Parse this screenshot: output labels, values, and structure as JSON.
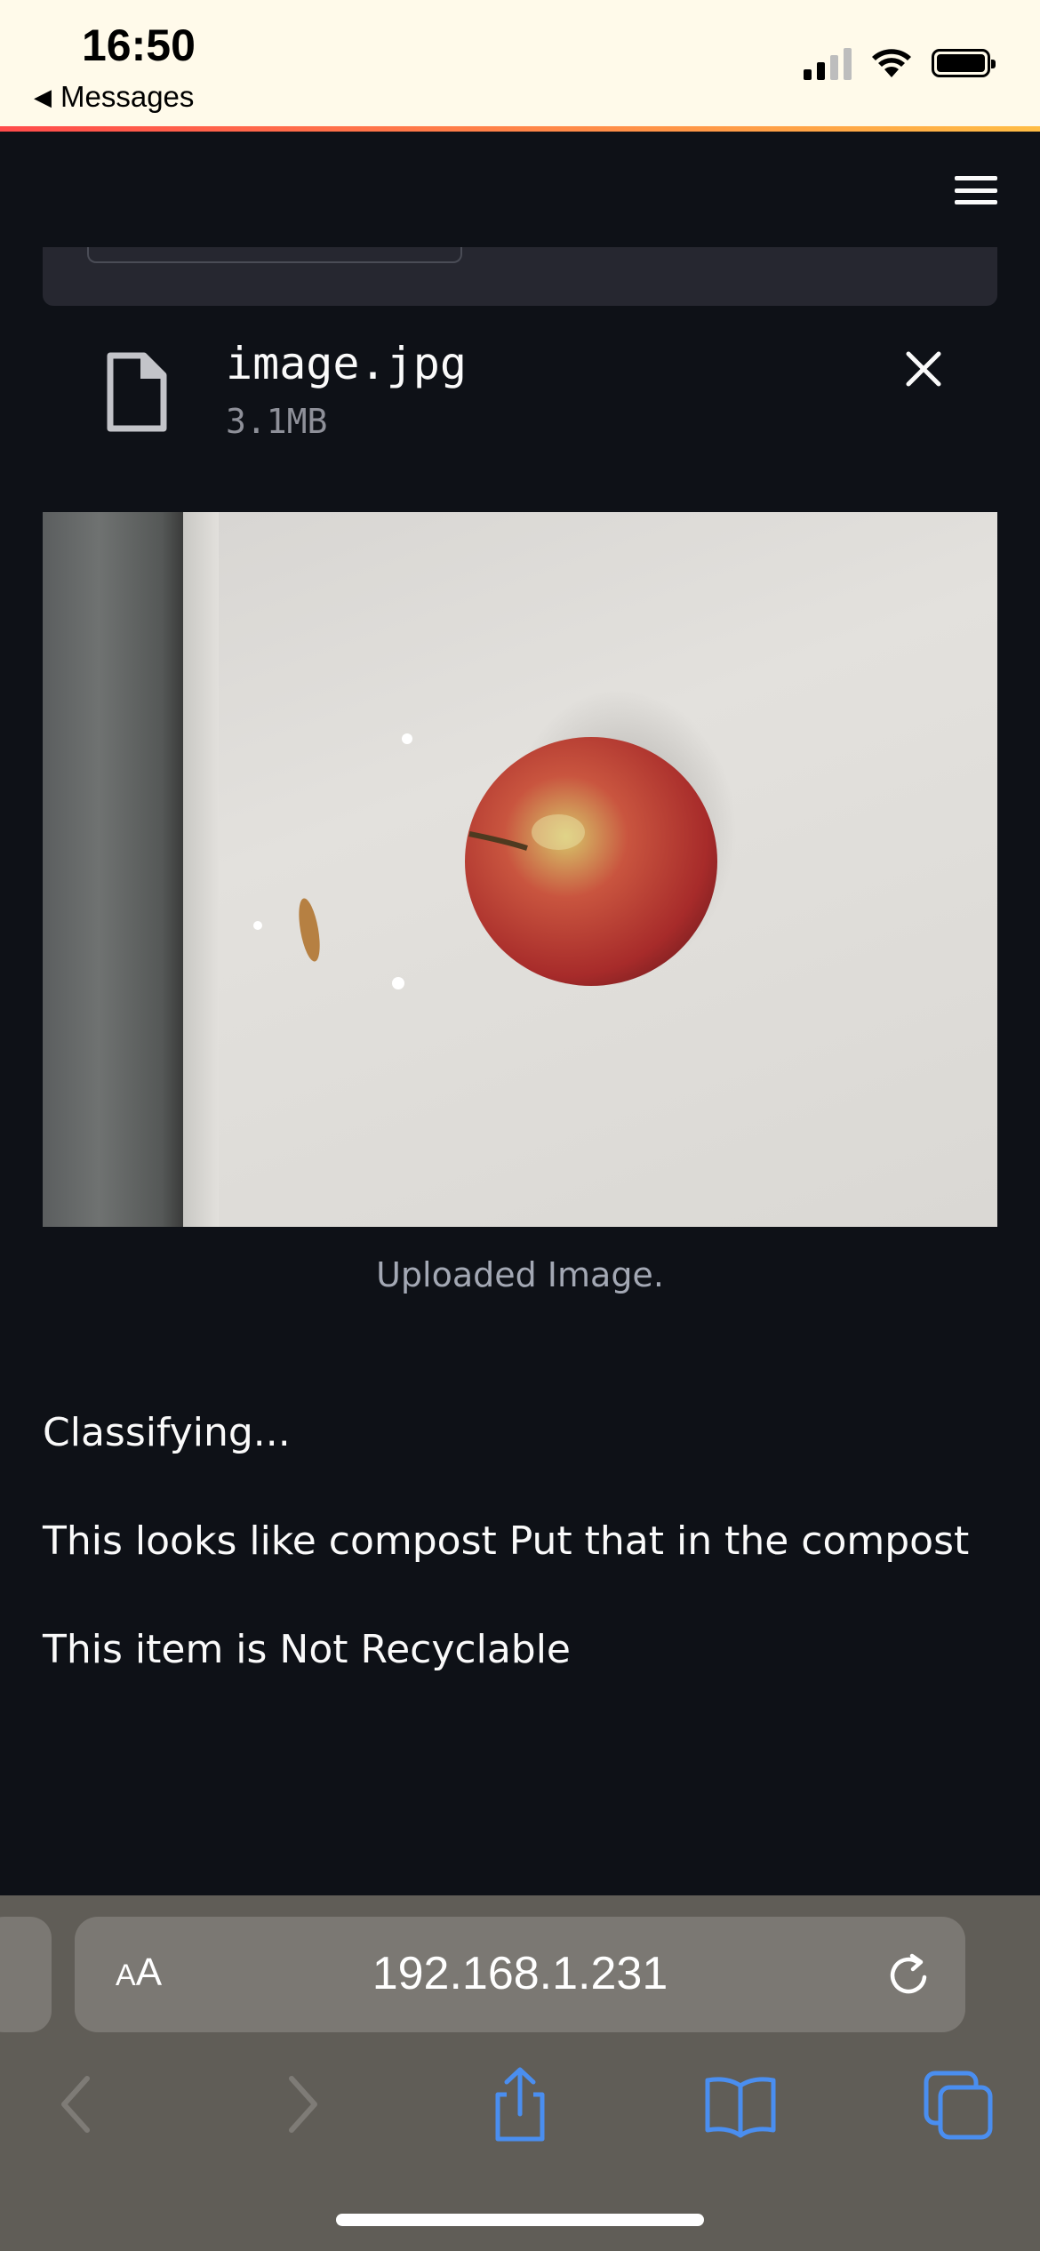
{
  "status_bar": {
    "time": "16:50",
    "back_app": "Messages"
  },
  "file": {
    "name": "image.jpg",
    "size": "3.1MB"
  },
  "image_caption": "Uploaded Image.",
  "messages": [
    "Classifying...",
    "This looks like compost Put that in the compost",
    "This item is Not Recyclable"
  ],
  "browser": {
    "aa_label_small": "A",
    "aa_label_big": "A",
    "url": "192.168.1.231"
  },
  "colors": {
    "app_background": "#0e1117",
    "uploader_background": "#262730",
    "safari_toolbar": "#605d57",
    "toolbar_icon_active": "#4a8ef0"
  },
  "icons": {
    "menu": "hamburger-icon",
    "file": "file-icon",
    "remove": "close-icon",
    "reload": "reload-icon",
    "back": "chevron-left-icon",
    "forward": "chevron-right-icon",
    "share": "share-icon",
    "bookmarks": "book-icon",
    "tabs": "tabs-icon"
  }
}
